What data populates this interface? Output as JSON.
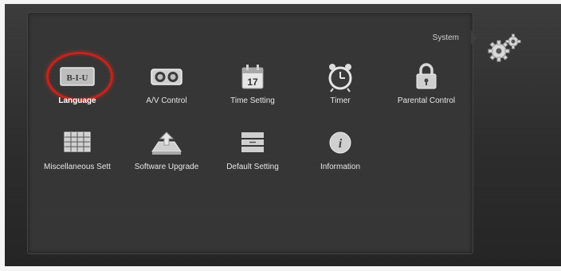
{
  "header": {
    "section_title": "System"
  },
  "menu": {
    "items": [
      {
        "label": "Language",
        "icon": "language-icon"
      },
      {
        "label": "A/V Control",
        "icon": "av-control-icon"
      },
      {
        "label": "Time Setting",
        "icon": "calendar-icon"
      },
      {
        "label": "Timer",
        "icon": "alarm-clock-icon"
      },
      {
        "label": "Parental Control",
        "icon": "lock-icon"
      },
      {
        "label": "Miscellaneous Sett",
        "icon": "grid-table-icon"
      },
      {
        "label": "Software Upgrade",
        "icon": "upgrade-icon"
      },
      {
        "label": "Default Setting",
        "icon": "default-setting-icon"
      },
      {
        "label": "Information",
        "icon": "info-icon"
      }
    ],
    "selected": "Language"
  },
  "icons": {
    "language_text": "B-I-U",
    "calendar_day": "17"
  },
  "colors": {
    "focus_ring": "#c3231c",
    "background": "#353535",
    "text": "#e6e6e6"
  }
}
